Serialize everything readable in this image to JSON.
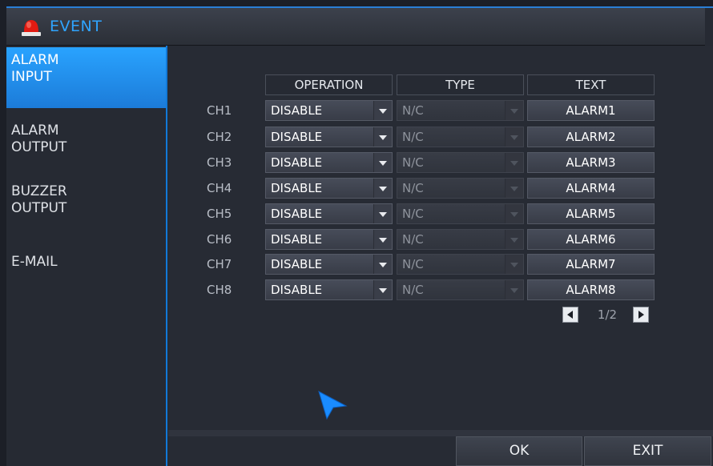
{
  "window": {
    "title": "EVENT",
    "icon": "alarm-siren-icon"
  },
  "sidebar": {
    "items": [
      {
        "label_line1": "ALARM",
        "label_line2": "INPUT",
        "active": true
      },
      {
        "label_line1": "ALARM",
        "label_line2": "OUTPUT",
        "active": false
      },
      {
        "label_line1": "BUZZER",
        "label_line2": "OUTPUT",
        "active": false
      },
      {
        "label_line1": "E-MAIL",
        "label_line2": "",
        "active": false
      }
    ]
  },
  "table": {
    "headers": {
      "operation": "OPERATION",
      "type": "TYPE",
      "text": "TEXT"
    },
    "rows": [
      {
        "channel": "CH1",
        "operation": "DISABLE",
        "type": "N/C",
        "text": "ALARM1"
      },
      {
        "channel": "CH2",
        "operation": "DISABLE",
        "type": "N/C",
        "text": "ALARM2"
      },
      {
        "channel": "CH3",
        "operation": "DISABLE",
        "type": "N/C",
        "text": "ALARM3"
      },
      {
        "channel": "CH4",
        "operation": "DISABLE",
        "type": "N/C",
        "text": "ALARM4"
      },
      {
        "channel": "CH5",
        "operation": "DISABLE",
        "type": "N/C",
        "text": "ALARM5"
      },
      {
        "channel": "CH6",
        "operation": "DISABLE",
        "type": "N/C",
        "text": "ALARM6"
      },
      {
        "channel": "CH7",
        "operation": "DISABLE",
        "type": "N/C",
        "text": "ALARM7"
      },
      {
        "channel": "CH8",
        "operation": "DISABLE",
        "type": "N/C",
        "text": "ALARM8"
      }
    ]
  },
  "pagination": {
    "current": "1/2"
  },
  "buttons": {
    "ok": "OK",
    "exit": "EXIT"
  },
  "colors": {
    "accent": "#1c7bd8",
    "title_text": "#2fa4ff",
    "background": "#262a33"
  }
}
